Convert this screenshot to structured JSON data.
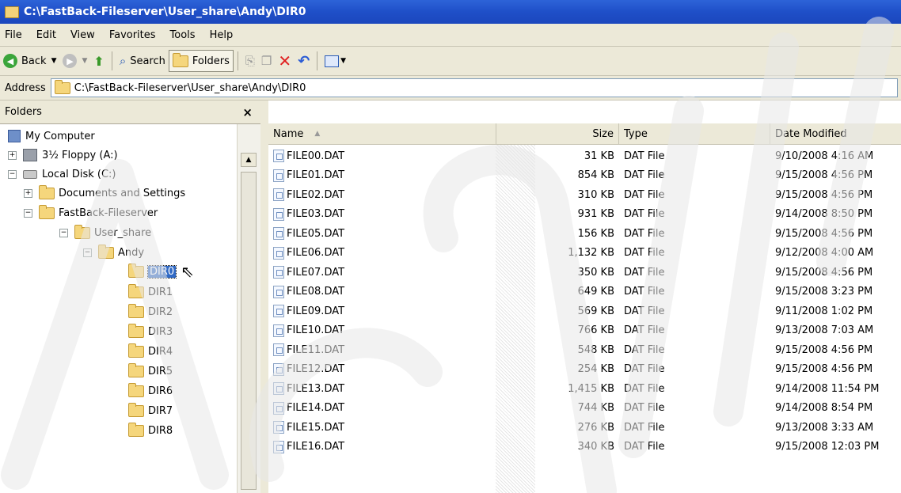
{
  "window": {
    "title": "C:\\FastBack-Fileserver\\User_share\\Andy\\DIR0"
  },
  "menu": [
    "File",
    "Edit",
    "View",
    "Favorites",
    "Tools",
    "Help"
  ],
  "toolbar": {
    "back": "Back",
    "search": "Search",
    "folders": "Folders"
  },
  "address": {
    "label": "Address",
    "value": "C:\\FastBack-Fileserver\\User_share\\Andy\\DIR0"
  },
  "folders_pane": {
    "title": "Folders",
    "close": "×",
    "tree": [
      {
        "label": "My Computer",
        "icon": "computer-icon"
      },
      {
        "label": "3½ Floppy (A:)",
        "icon": "floppy-icon",
        "expander": "+"
      },
      {
        "label": "Local Disk (C:)",
        "icon": "disk-icon",
        "expander": "−"
      },
      {
        "label": "Documents and Settings",
        "icon": "folder-icon",
        "expander": "+"
      },
      {
        "label": "FastBack-Fileserver",
        "icon": "folder-icon",
        "expander": "−"
      },
      {
        "label": "User_share",
        "icon": "folder-icon",
        "expander": "−"
      },
      {
        "label": "Andy",
        "icon": "folder-icon",
        "expander": "−"
      },
      {
        "label": "DIR0",
        "icon": "folder-icon",
        "selected": true
      },
      {
        "label": "DIR1",
        "icon": "folder-icon"
      },
      {
        "label": "DIR2",
        "icon": "folder-icon"
      },
      {
        "label": "DIR3",
        "icon": "folder-icon"
      },
      {
        "label": "DIR4",
        "icon": "folder-icon"
      },
      {
        "label": "DIR5",
        "icon": "folder-icon"
      },
      {
        "label": "DIR6",
        "icon": "folder-icon"
      },
      {
        "label": "DIR7",
        "icon": "folder-icon"
      },
      {
        "label": "DIR8",
        "icon": "folder-icon"
      }
    ]
  },
  "list": {
    "columns": [
      "Name",
      "Size",
      "Type",
      "Date Modified"
    ],
    "sort_indicator": "▲",
    "rows": [
      {
        "name": "FILE00.DAT",
        "size": "31 KB",
        "type": "DAT File",
        "date": "9/10/2008 4:16 AM"
      },
      {
        "name": "FILE01.DAT",
        "size": "854 KB",
        "type": "DAT File",
        "date": "9/15/2008 4:56 PM"
      },
      {
        "name": "FILE02.DAT",
        "size": "310 KB",
        "type": "DAT File",
        "date": "9/15/2008 4:56 PM"
      },
      {
        "name": "FILE03.DAT",
        "size": "931 KB",
        "type": "DAT File",
        "date": "9/14/2008 8:50 PM"
      },
      {
        "name": "FILE05.DAT",
        "size": "156 KB",
        "type": "DAT File",
        "date": "9/15/2008 4:56 PM"
      },
      {
        "name": "FILE06.DAT",
        "size": "1,132 KB",
        "type": "DAT File",
        "date": "9/12/2008 4:00 AM"
      },
      {
        "name": "FILE07.DAT",
        "size": "350 KB",
        "type": "DAT File",
        "date": "9/15/2008 4:56 PM"
      },
      {
        "name": "FILE08.DAT",
        "size": "649 KB",
        "type": "DAT File",
        "date": "9/15/2008 3:23 PM"
      },
      {
        "name": "FILE09.DAT",
        "size": "569 KB",
        "type": "DAT File",
        "date": "9/11/2008 1:02 PM"
      },
      {
        "name": "FILE10.DAT",
        "size": "766 KB",
        "type": "DAT File",
        "date": "9/13/2008 7:03 AM"
      },
      {
        "name": "FILE11.DAT",
        "size": "548 KB",
        "type": "DAT File",
        "date": "9/15/2008 4:56 PM"
      },
      {
        "name": "FILE12.DAT",
        "size": "254 KB",
        "type": "DAT File",
        "date": "9/15/2008 4:56 PM"
      },
      {
        "name": "FILE13.DAT",
        "size": "1,415 KB",
        "type": "DAT File",
        "date": "9/14/2008 11:54 PM"
      },
      {
        "name": "FILE14.DAT",
        "size": "744 KB",
        "type": "DAT File",
        "date": "9/14/2008 8:54 PM"
      },
      {
        "name": "FILE15.DAT",
        "size": "276 KB",
        "type": "DAT File",
        "date": "9/13/2008 3:33 AM"
      },
      {
        "name": "FILE16.DAT",
        "size": "340 KB",
        "type": "DAT File",
        "date": "9/15/2008 12:03 PM"
      }
    ]
  }
}
